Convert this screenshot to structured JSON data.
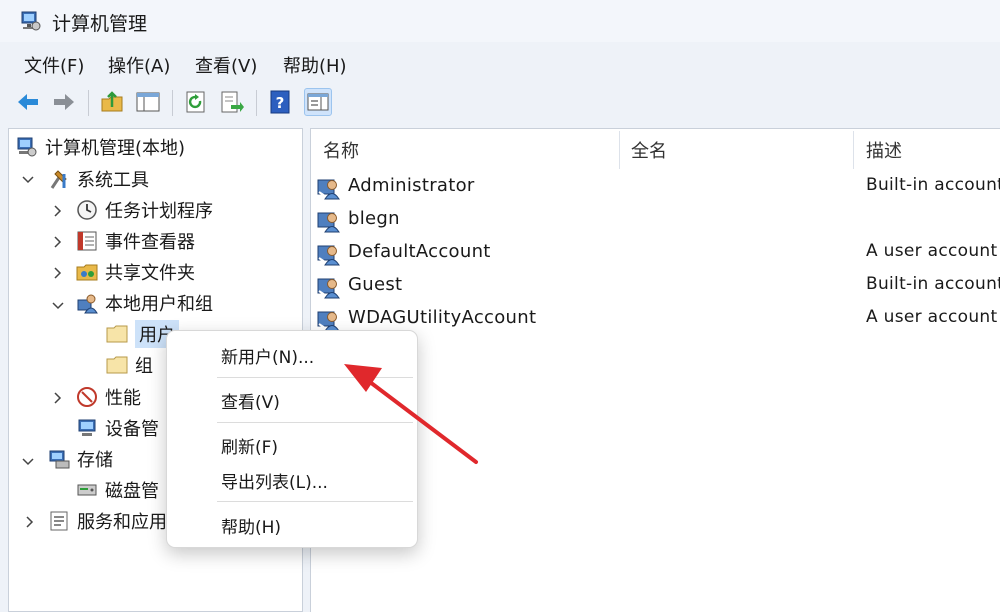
{
  "window": {
    "title": "计算机管理"
  },
  "menubar": [
    "文件(F)",
    "操作(A)",
    "查看(V)",
    "帮助(H)"
  ],
  "toolbar": {
    "buttons": [
      "back-icon",
      "forward-icon",
      "up-folder-icon",
      "console-tree-icon",
      "refresh-icon",
      "export-list-icon",
      "help-icon",
      "action-pane-icon"
    ],
    "active": "action-pane-icon"
  },
  "tree": {
    "root": "计算机管理(本地)",
    "system_tools": "系统工具",
    "task_scheduler": "任务计划程序",
    "event_viewer": "事件查看器",
    "shared_folders": "共享文件夹",
    "local_users_groups": "本地用户和组",
    "users": "用户",
    "groups": "组",
    "performance": "性能",
    "device_manager": "设备管",
    "storage": "存储",
    "disk_management": "磁盘管",
    "services_apps": "服务和应用"
  },
  "list": {
    "columns": [
      "名称",
      "全名",
      "描述"
    ],
    "rows": [
      {
        "name": "Administrator",
        "full_name": "",
        "description": "Built-in account"
      },
      {
        "name": "blegn",
        "full_name": "",
        "description": ""
      },
      {
        "name": "DefaultAccount",
        "full_name": "",
        "description": "A user account"
      },
      {
        "name": "Guest",
        "full_name": "",
        "description": "Built-in account"
      },
      {
        "name": "WDAGUtilityAccount",
        "full_name": "",
        "description": "A user account"
      }
    ]
  },
  "context_menu": {
    "new_user": "新用户(N)...",
    "view": "查看(V)",
    "refresh": "刷新(F)",
    "export_list": "导出列表(L)...",
    "help": "帮助(H)"
  },
  "colors": {
    "accent": "#1e7fd6",
    "arrow": "#e0282c",
    "selection": "#cde2f9"
  }
}
